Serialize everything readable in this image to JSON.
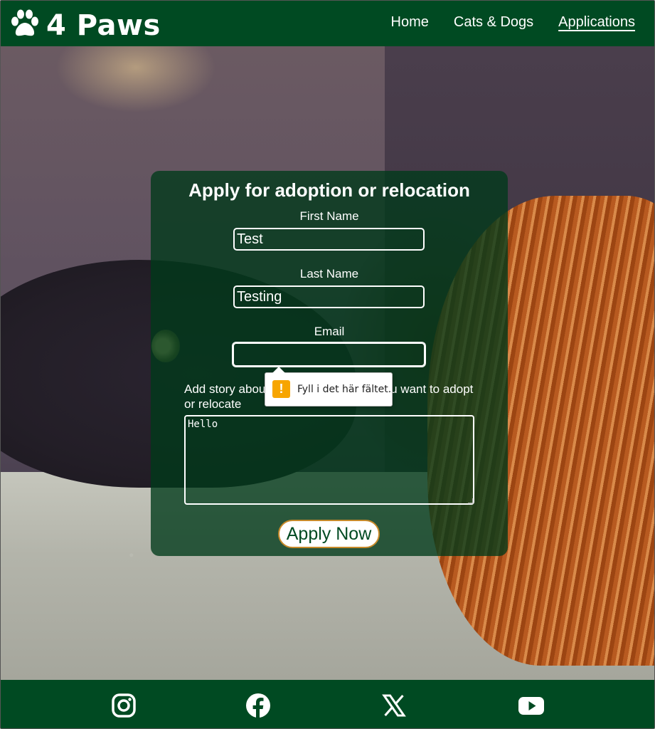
{
  "header": {
    "logo_text": "4 Paws",
    "logo_icon": "paw-icon",
    "nav": [
      {
        "label": "Home",
        "active": false
      },
      {
        "label": "Cats & Dogs",
        "active": false
      },
      {
        "label": "Applications",
        "active": true
      }
    ]
  },
  "form": {
    "title": "Apply for adoption or relocation",
    "first_name": {
      "label": "First Name",
      "value": "Test"
    },
    "last_name": {
      "label": "Last Name",
      "value": "Testing"
    },
    "email": {
      "label": "Email",
      "value": ""
    },
    "story": {
      "label": "Add story about you and the animal you want to adopt or relocate",
      "value": "Hello"
    },
    "submit_label": "Apply Now"
  },
  "validation_tooltip": {
    "message": "Fyll i det här fältet.",
    "icon": "warning-icon",
    "icon_color": "#f7a500"
  },
  "footer": {
    "social_icons": [
      "instagram-icon",
      "facebook-icon",
      "x-icon",
      "youtube-icon"
    ]
  },
  "colors": {
    "brand_green": "#004a22",
    "button_border": "#c88a2a"
  }
}
